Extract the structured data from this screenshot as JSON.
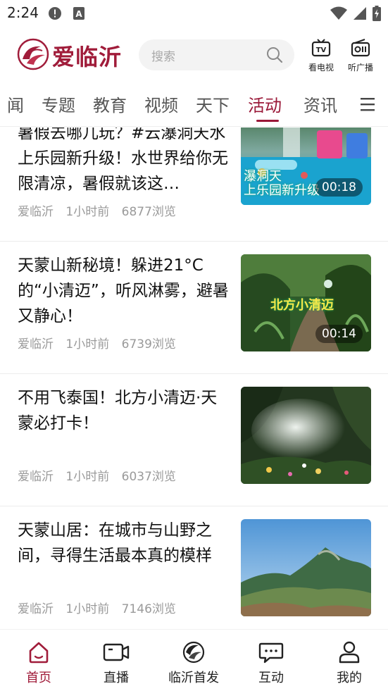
{
  "status_bar": {
    "time": "2:24",
    "icons": [
      "alert-icon",
      "a-badge-icon",
      "wifi-icon",
      "signal-icon",
      "battery-charging-icon"
    ]
  },
  "header": {
    "logo_text": "爱临沂",
    "search_placeholder": "搜索",
    "tv_label": "看电视",
    "radio_label": "听广播",
    "accent_color": "#a01c3a"
  },
  "tabs": {
    "items": [
      "闻",
      "专题",
      "教育",
      "视频",
      "天下",
      "活动",
      "资讯"
    ],
    "active": "活动"
  },
  "feed": [
    {
      "title": "暑假去哪儿玩？#云瀑洞天水上乐园新升级！水世界给你无限清凉，暑假就该这…",
      "source": "爱临沂",
      "time": "1小时前",
      "views": "6877浏览",
      "duration": "00:18",
      "thumb_caption": "瀑洞天\n上乐园新升级"
    },
    {
      "title": "天蒙山新秘境！躲进21°C的“小清迈”，听风淋雾，避暑又静心！",
      "source": "爱临沂",
      "time": "1小时前",
      "views": "6739浏览",
      "duration": "00:14",
      "thumb_caption": "北方小清迈"
    },
    {
      "title": "不用飞泰国！北方小清迈·天蒙必打卡！",
      "source": "爱临沂",
      "time": "1小时前",
      "views": "6037浏览"
    },
    {
      "title": "天蒙山居：在城市与山野之间，寻得生活最本真的模样",
      "source": "爱临沂",
      "time": "1小时前",
      "views": "7146浏览"
    }
  ],
  "bottom_nav": {
    "items": [
      "首页",
      "直播",
      "临沂首发",
      "互动",
      "我的"
    ],
    "active": "首页"
  }
}
